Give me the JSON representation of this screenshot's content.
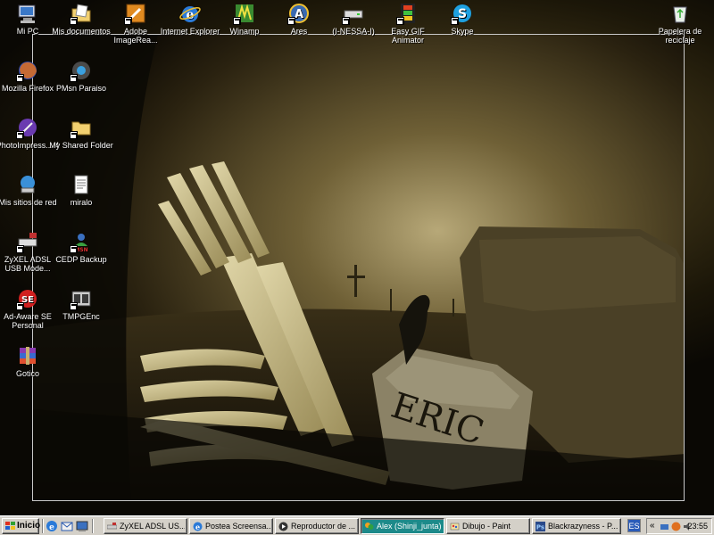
{
  "desktop": {
    "icons": [
      {
        "label": "Mi PC",
        "icon": "my-computer-icon"
      },
      {
        "label": "Mis documentos",
        "icon": "my-documents-icon"
      },
      {
        "label": "Adobe ImageRea...",
        "icon": "adobe-imageready-icon"
      },
      {
        "label": "Internet Explorer",
        "icon": "internet-explorer-icon"
      },
      {
        "label": "Winamp",
        "icon": "winamp-icon"
      },
      {
        "label": "Ares",
        "icon": "ares-icon"
      },
      {
        "label": "(I-NESSA-I)",
        "icon": "drive-icon"
      },
      {
        "label": "Easy GIF Animator",
        "icon": "easy-gif-animator-icon"
      },
      {
        "label": "Skype",
        "icon": "skype-icon"
      },
      {
        "label": "Papelera de reciclaje",
        "icon": "recycle-bin-icon"
      },
      {
        "label": "Mozilla Firefox",
        "icon": "firefox-icon"
      },
      {
        "label": "PMsn Paraiso",
        "icon": "pmsn-icon"
      },
      {
        "label": "PhotoImpress... 4",
        "icon": "photoimpression-icon"
      },
      {
        "label": "My Shared Folder",
        "icon": "shared-folder-icon"
      },
      {
        "label": "Mis sitios de red",
        "icon": "network-places-icon"
      },
      {
        "label": "miralo",
        "icon": "text-document-icon"
      },
      {
        "label": "ZyXEL ADSL USB Mode...",
        "icon": "zyxel-modem-icon"
      },
      {
        "label": "CEDP Backup",
        "icon": "msn-backup-icon"
      },
      {
        "label": "Ad-Aware SE Personal",
        "icon": "ad-aware-icon"
      },
      {
        "label": "TMPGEnc",
        "icon": "tmpgenc-icon"
      },
      {
        "label": "Gotico",
        "icon": "winrar-archive-icon"
      }
    ]
  },
  "taskbar": {
    "start_label": "Inicio",
    "tasks": [
      {
        "label": "ZyXEL ADSL US...",
        "icon": "zyxel-icon"
      },
      {
        "label": "Postea Screensa...",
        "icon": "ie-window-icon"
      },
      {
        "label": "Reproductor de ...",
        "icon": "media-player-icon"
      },
      {
        "label": "Alex (Shinji_junta)...",
        "icon": "msn-chat-icon"
      },
      {
        "label": "Dibujo - Paint",
        "icon": "paint-icon"
      },
      {
        "label": "Blackrazyness - P...",
        "icon": "photoshop-icon"
      }
    ],
    "language": "ES",
    "tray_chevron": "«",
    "clock": "23:55"
  },
  "colors": {
    "taskbar_bg": "#d4d0c8",
    "active_task": "#1d8a8a",
    "wallpaper_dark": "#1b1608",
    "wallpaper_sky": "#6a5a32"
  }
}
